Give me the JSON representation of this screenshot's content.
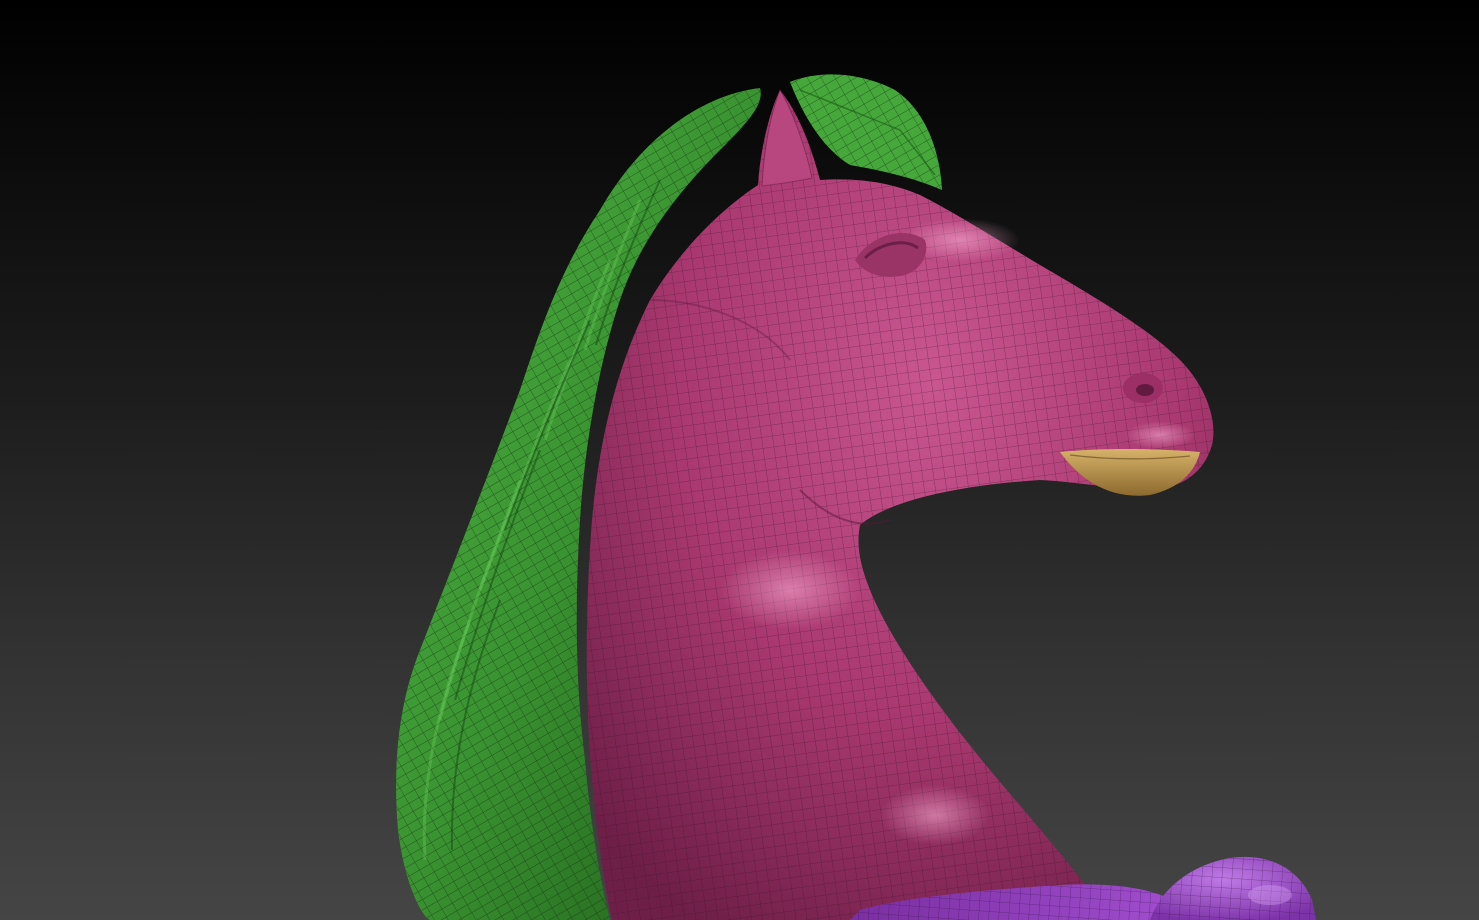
{
  "viewport": {
    "background_top": "#000000",
    "background_bottom": "#454545"
  },
  "model": {
    "polygroups": [
      {
        "name": "head-neck",
        "color": "#b8427a"
      },
      {
        "name": "mane",
        "color": "#3f9f36"
      },
      {
        "name": "mane-tuft",
        "color": "#47a83c"
      },
      {
        "name": "lower-lip",
        "color": "#c8a05a"
      },
      {
        "name": "chest-band",
        "color": "#9b3fbf"
      },
      {
        "name": "knee",
        "color": "#a04acd"
      }
    ],
    "wireframe_color": "#3a1226"
  }
}
